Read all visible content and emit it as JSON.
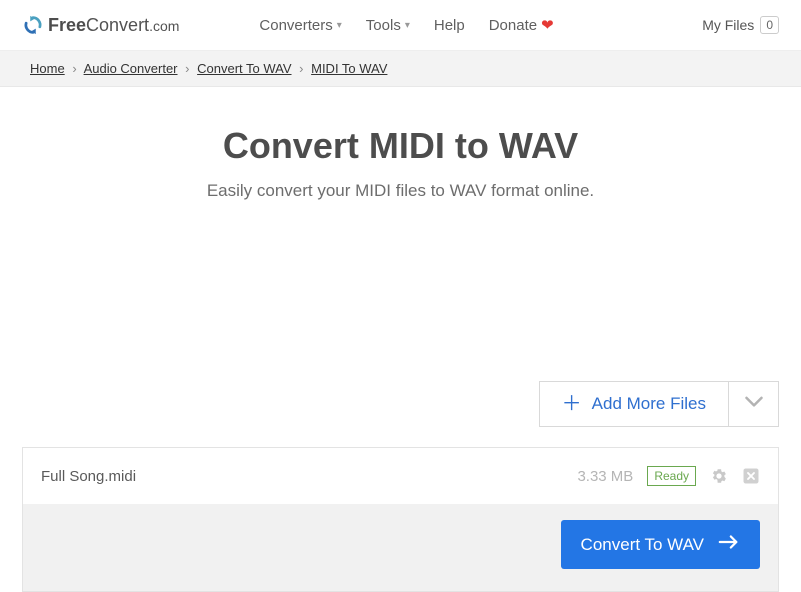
{
  "header": {
    "logo_free": "Free",
    "logo_convert": "Convert",
    "logo_dotcom": ".com",
    "nav": {
      "converters": "Converters",
      "tools": "Tools",
      "help": "Help",
      "donate": "Donate"
    },
    "myfiles_label": "My Files",
    "myfiles_count": "0"
  },
  "breadcrumb": {
    "home": "Home",
    "audio_converter": "Audio Converter",
    "convert_to_wav": "Convert To WAV",
    "midi_to_wav": "MIDI To WAV"
  },
  "hero": {
    "title": "Convert MIDI to WAV",
    "subtitle": "Easily convert your MIDI files to WAV format online."
  },
  "actions": {
    "add_more": "Add More Files"
  },
  "file": {
    "name": "Full Song.midi",
    "size": "3.33 MB",
    "status": "Ready"
  },
  "convert": {
    "button": "Convert To WAV"
  }
}
